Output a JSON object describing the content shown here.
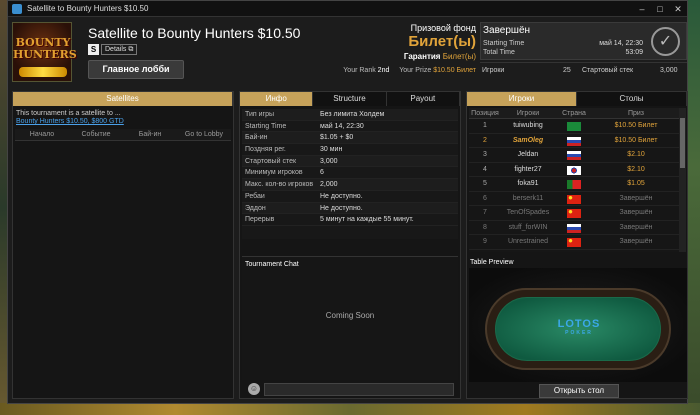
{
  "window": {
    "title": "Satellite to Bounty Hunters $10.50",
    "controls": [
      "–",
      "□",
      "✕"
    ]
  },
  "header": {
    "logo_text": "BOUNTY HUNTERS",
    "tournament_name": "Satellite to Bounty Hunters $10.50",
    "speed_badge": "S",
    "details_label": "Details",
    "main_lobby_label": "Главное лобби",
    "prize_pool_label": "Призовой фонд",
    "prize_pool_value": "Билет(ы)",
    "guarantee_label": "Гарантия",
    "guarantee_value": "Билет(ы)",
    "your_rank_label": "Your Rank",
    "your_rank_value": "2nd",
    "your_prize_label": "Your Prize",
    "your_prize_value": "$10.50 Билет"
  },
  "status": {
    "title": "Завершён",
    "starting_time_label": "Starting Time",
    "starting_time_value": "май 14, 22:30",
    "total_time_label": "Total Time",
    "total_time_value": "53:09",
    "players_label": "Игроки",
    "players_value": "25",
    "starting_stack_label": "Стартовый стек",
    "starting_stack_value": "3,000"
  },
  "left_panel": {
    "tab": "Satellites",
    "satellite_text": "This tournament is a satellite to ...",
    "satellite_link": "Bounty Hunters $10.50, $800 GTD",
    "columns": [
      "Начало",
      "Событие",
      "Бай-ин",
      "Go to Lobby"
    ]
  },
  "mid_panel": {
    "tabs": [
      "Инфо",
      "Structure",
      "Payout"
    ],
    "info_rows": [
      {
        "k": "Тип игры",
        "v": "Без лимита Холдем"
      },
      {
        "k": "Starting Time",
        "v": "май 14, 22:30"
      },
      {
        "k": "Бай-ин",
        "v": "$1.05 + $0"
      },
      {
        "k": "Поздняя рег.",
        "v": "30 мин"
      },
      {
        "k": "Стартовый стек",
        "v": "3,000"
      },
      {
        "k": "Минимум игроков",
        "v": "6"
      },
      {
        "k": "Макс. кол-во игроков",
        "v": "2,000"
      },
      {
        "k": "Ребаи",
        "v": "Не доступно."
      },
      {
        "k": "Эддон",
        "v": "Не доступно."
      },
      {
        "k": "Перерыв",
        "v": "5 минут на каждые 55 минут."
      }
    ],
    "chat_title": "Tournament Chat",
    "chat_placeholder": "Coming Soon"
  },
  "right_panel": {
    "tabs": [
      "Игроки",
      "Столы"
    ],
    "columns": [
      "Позиция",
      "Игроки",
      "Страна",
      "Приз"
    ],
    "players": [
      {
        "pos": "1",
        "name": "tuiwubing",
        "flag": "flag-saudi",
        "prize": "$10.50 Билет",
        "highlight": false,
        "done": false
      },
      {
        "pos": "2",
        "name": "SamOleg",
        "flag": "flag-russia",
        "prize": "$10.50 Билет",
        "highlight": true,
        "done": false
      },
      {
        "pos": "3",
        "name": "Jeldan",
        "flag": "flag-russia",
        "prize": "$2.10",
        "highlight": false,
        "done": false
      },
      {
        "pos": "4",
        "name": "fighter27",
        "flag": "flag-korea",
        "prize": "$2.10",
        "highlight": false,
        "done": false
      },
      {
        "pos": "5",
        "name": "foka91",
        "flag": "flag-portugal",
        "prize": "$1.05",
        "highlight": false,
        "done": false
      },
      {
        "pos": "6",
        "name": "berserk11",
        "flag": "flag-china",
        "prize": "Завершён",
        "highlight": false,
        "done": true
      },
      {
        "pos": "7",
        "name": "TenOfSpades",
        "flag": "flag-china",
        "prize": "Завершён",
        "highlight": false,
        "done": true
      },
      {
        "pos": "8",
        "name": "stuff_forWIN",
        "flag": "flag-russia",
        "prize": "Завершён",
        "highlight": false,
        "done": true
      },
      {
        "pos": "9",
        "name": "Unrestrained",
        "flag": "flag-china",
        "prize": "Завершён",
        "highlight": false,
        "done": true
      }
    ],
    "preview_title": "Table Preview",
    "table_logo": "LOTOS",
    "table_logo_sub": "POKER",
    "open_table_label": "Открыть стол"
  },
  "colors": {
    "accent": "#c6a25a",
    "prize": "#e0a33a",
    "link": "#4aa0e8",
    "felt": "#1f7a56"
  }
}
